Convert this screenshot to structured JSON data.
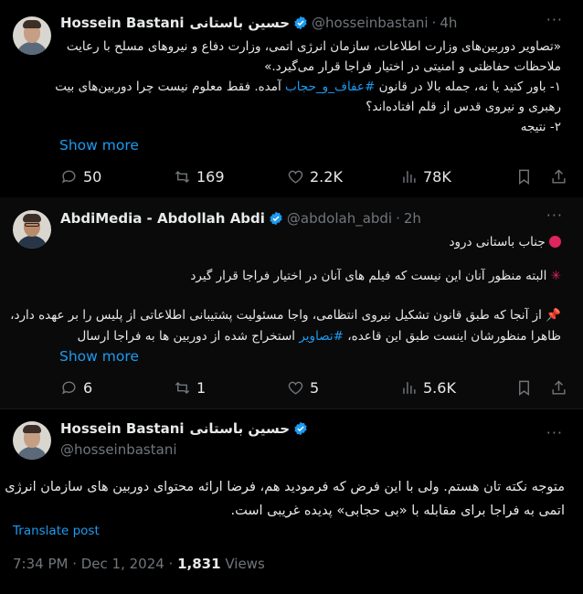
{
  "tweet1": {
    "name": "Hossein Bastani",
    "name_fa": "حسین باستانی",
    "handle": "@hosseinbastani",
    "time": "4h",
    "lines": [
      "«تصاویر دوربین‌های وزارت اطلاعات، سازمان انرژی اتمی، وزارت دفاع و نیروهای مسلح با رعایت",
      "ملاحظات حفاظتی و امنیتی در اختیار فراجا قرار می‌گیرد.»"
    ],
    "line3_pre": "۱- باور کنید یا نه، جمله بالا در قانون",
    "hashtag": "#عفاف_و_حجاب",
    "line3_post": "آمده. فقط معلوم نیست چرا دوربین‌های بیت",
    "line4": "رهبری و نیروی قدس از قلم افتاده‌اند؟",
    "line5": "۲- نتیجه",
    "show_more": "Show more",
    "replies": "50",
    "reposts": "169",
    "likes": "2.2K",
    "views": "78K"
  },
  "tweet2": {
    "name": "AbdiMedia - Abdollah Abdi",
    "handle": "@abdolah_abdi",
    "time": "2h",
    "line1": "جناب باستانی درود",
    "line2": "البته منظور آنان این نیست که فیلم های آنان در اختیار فراجا قرار گیرد",
    "line3": "از آنجا که طبق قانون تشکیل نیروی انتظامی، واجا مسئولیت پشتیبانی اطلاعاتی از پلیس را بر عهده دارد،",
    "line4_pre": "ظاهرا منظورشان اینست طبق این قاعده،",
    "hashtag": "#تصاویر",
    "line4_post": "استخراج شده از دوربین ها به فراجا ارسال",
    "show_more": "Show more",
    "replies": "6",
    "reposts": "1",
    "likes": "5",
    "views": "5.6K"
  },
  "tweet3": {
    "name": "Hossein Bastani",
    "name_fa": "حسین باستانی",
    "handle": "@hosseinbastani",
    "line1": "متوجه نکته تان هستم. ولی با این فرض که فرمودید هم، فرضا ارائه محتوای دوربین های سازمان انرژی",
    "line2": "اتمی به فراجا برای مقابله با «بی حجابی» پدیده غریبی است.",
    "translate": "Translate post",
    "time": "7:34 PM · Dec 1, 2024 ·",
    "views_count": "1,831",
    "views_label": "Views"
  },
  "colors": {
    "accent": "#1d9bf0",
    "muted": "#71767b",
    "text": "#e7e9ea",
    "verified": "#1d9bf0"
  }
}
